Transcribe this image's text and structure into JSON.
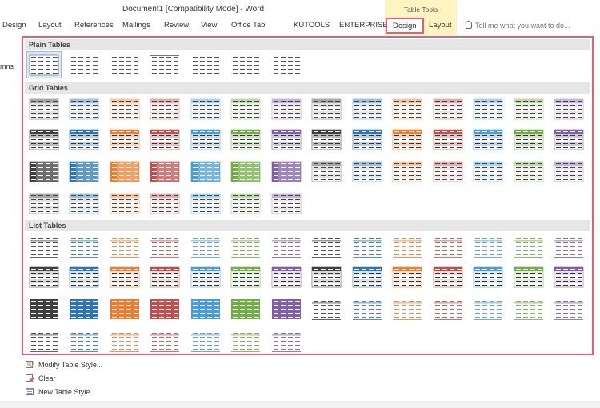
{
  "window": {
    "title": "Document1 [Compatibility Mode] - Word"
  },
  "context_group": {
    "label": "Table Tools"
  },
  "tabs": [
    {
      "label": "Design"
    },
    {
      "label": "Layout"
    },
    {
      "label": "References"
    },
    {
      "label": "Mailings"
    },
    {
      "label": "Review"
    },
    {
      "label": "View"
    },
    {
      "label": "Office Tab"
    },
    {
      "label": "KUTOOLS"
    },
    {
      "label": "ENTERPRISE"
    },
    {
      "label": "Design"
    },
    {
      "label": "Layout"
    }
  ],
  "tell_me": {
    "placeholder": "Tell me what you want to do..."
  },
  "left_fragment": "mns",
  "gallery": {
    "sections": [
      {
        "title": "Plain Tables"
      },
      {
        "title": "Grid Tables"
      },
      {
        "title": "List Tables"
      }
    ],
    "accent_colors": {
      "black": "#3f3f3f",
      "blue": "#2e75b6",
      "orange": "#ed7d31",
      "red": "#c0504d",
      "sky": "#4a9bd7",
      "green": "#70ad47",
      "purple": "#7f5fa8",
      "gold": "#b08a3c",
      "selection": "#9dbde8",
      "highlight_border": "#e0607b"
    }
  },
  "menu": {
    "modify": "Modify Table Style...",
    "clear": "Clear",
    "new": "New Table Style..."
  }
}
